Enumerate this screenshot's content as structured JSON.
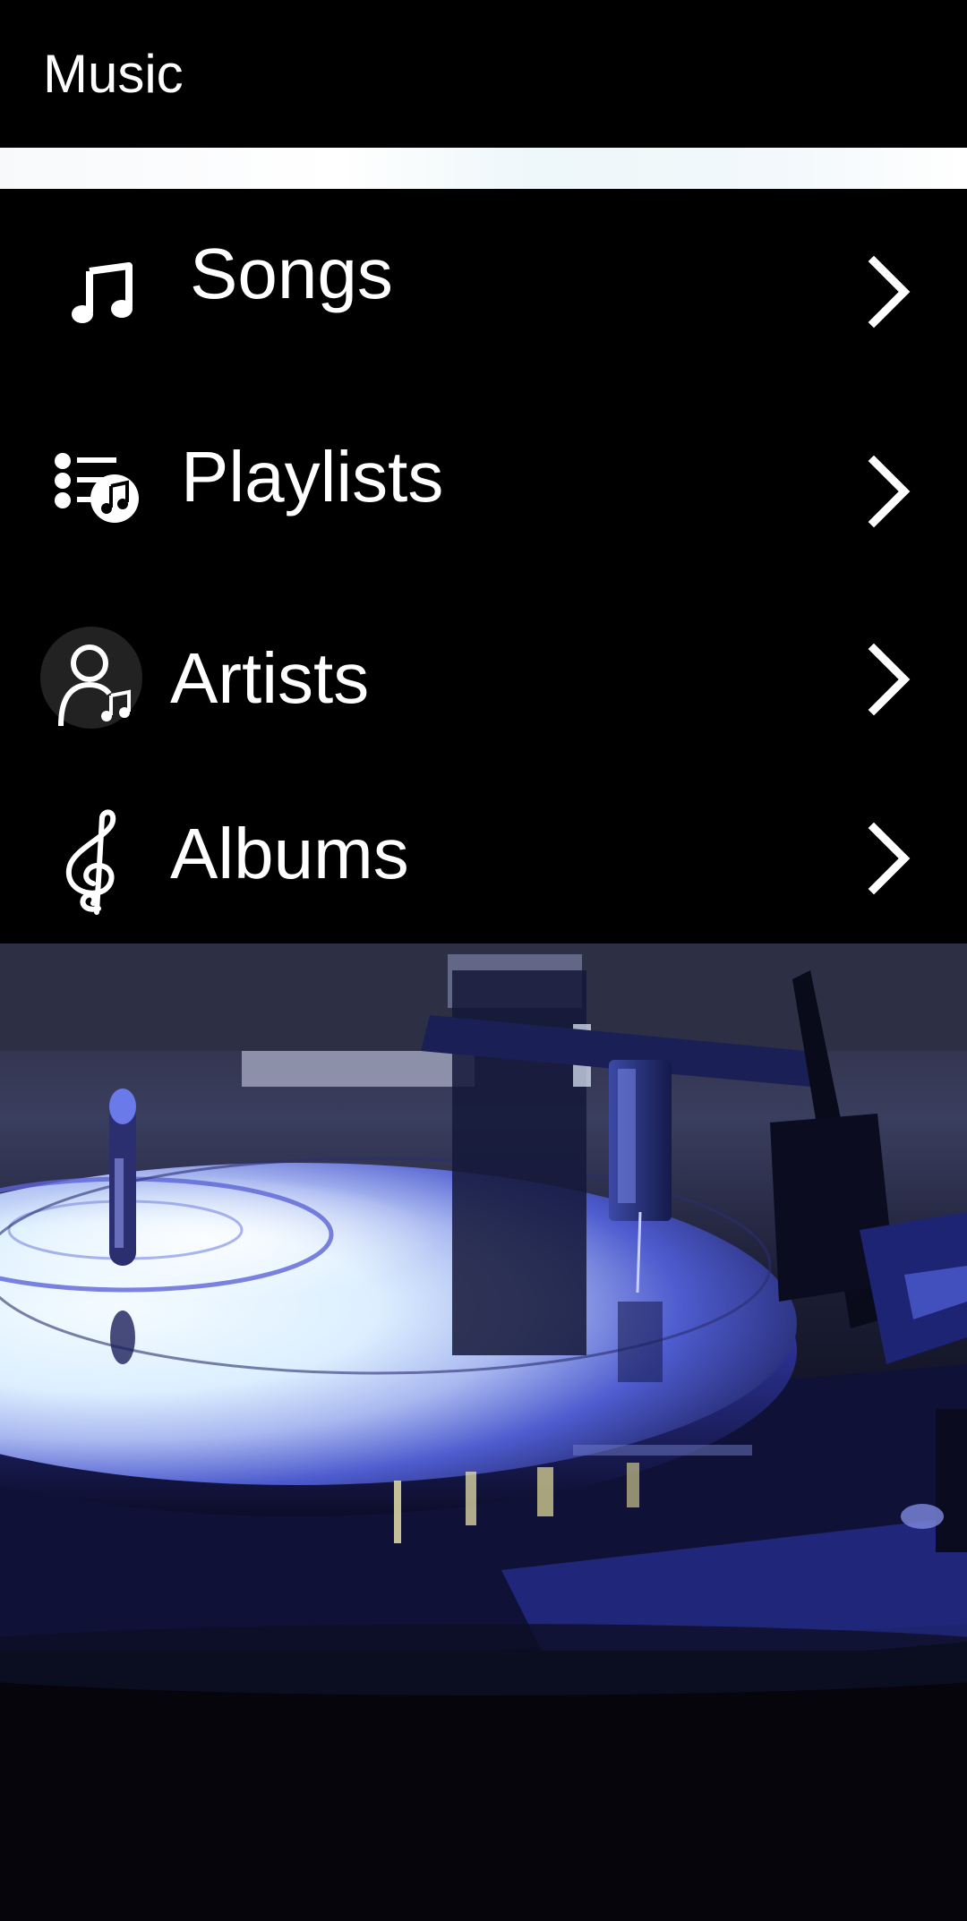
{
  "app_bar": {
    "title": "Music"
  },
  "menu": {
    "items": [
      {
        "label": "Songs",
        "icon": "music-note-icon"
      },
      {
        "label": "Playlists",
        "icon": "playlist-music-icon"
      },
      {
        "label": "Artists",
        "icon": "artist-music-icon"
      },
      {
        "label": "Albums",
        "icon": "treble-clef-icon"
      }
    ],
    "chevron_icon": "chevron-right-icon"
  },
  "hero": {
    "image_subject": "turntable-record-image"
  },
  "colors": {
    "background": "#000000",
    "text": "#ffffff",
    "strip": "#f7f9fb",
    "record_glow": "#e8f2ff",
    "record_blue": "#4a5bd8"
  }
}
